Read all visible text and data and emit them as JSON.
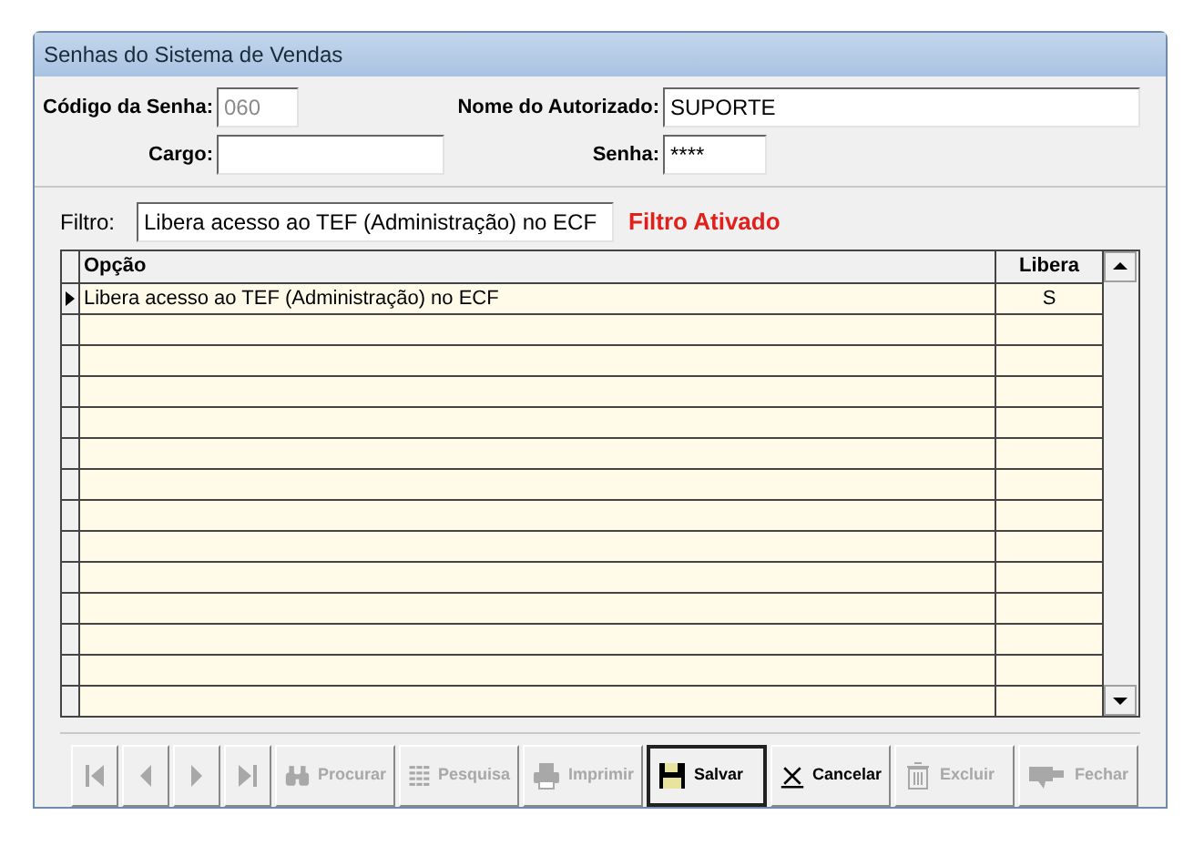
{
  "window": {
    "title": "Senhas do Sistema de Vendas"
  },
  "fields": {
    "codigo": {
      "label": "Código da Senha:",
      "value": "060",
      "disabled": true
    },
    "nome": {
      "label": "Nome do Autorizado:",
      "value": "SUPORTE"
    },
    "cargo": {
      "label": "Cargo:"
    },
    "senha": {
      "label": "Senha:",
      "value": "****"
    }
  },
  "filter": {
    "label": "Filtro:",
    "value": "Libera acesso ao TEF (Administração) no ECF",
    "status": "Filtro Ativado"
  },
  "table": {
    "columns": [
      "Opção",
      "Libera"
    ],
    "rows": [
      {
        "cells": [
          "Libera acesso ao TEF (Administração) no ECF",
          "S"
        ],
        "selected": true
      }
    ]
  },
  "buttons": [
    {
      "kind": "first",
      "disabled": true
    },
    {
      "kind": "prev",
      "disabled": true
    },
    {
      "kind": "next",
      "disabled": true
    },
    {
      "kind": "last",
      "disabled": true
    },
    {
      "kind": "binoculars",
      "label": "Procurar",
      "disabled": true
    },
    {
      "kind": "grid",
      "label": "Pesquisa",
      "disabled": true
    },
    {
      "kind": "printer",
      "label": "Imprimir",
      "disabled": true
    },
    {
      "kind": "floppy",
      "label": "Salvar",
      "disabled": false,
      "default": true
    },
    {
      "kind": "cancel",
      "label": "Cancelar",
      "disabled": false
    },
    {
      "kind": "trash",
      "label": "Excluir",
      "disabled": true
    },
    {
      "kind": "exit",
      "label": "Fechar",
      "disabled": true
    }
  ]
}
